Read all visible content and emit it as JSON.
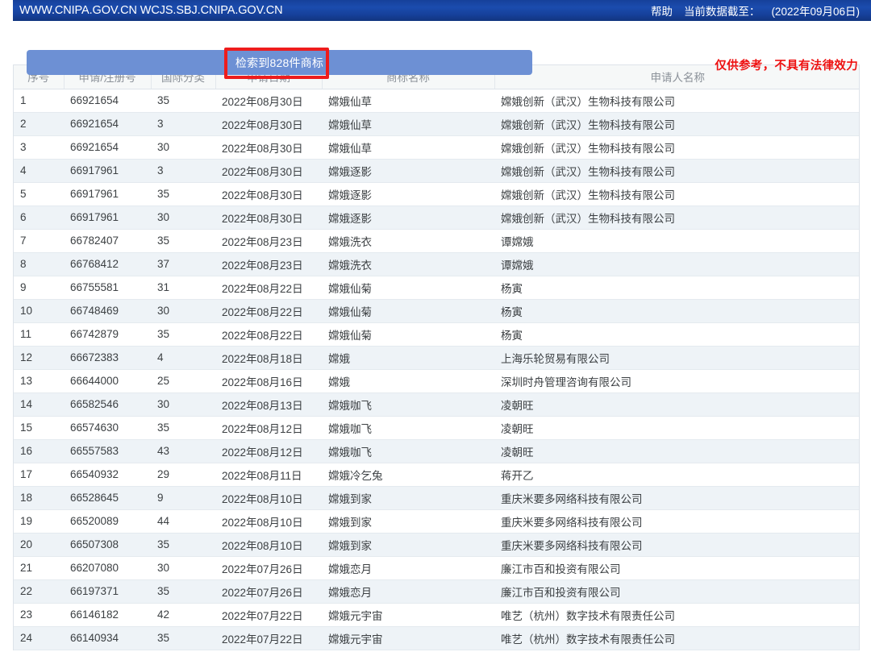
{
  "topbar": {
    "site_urls": "WWW.CNIPA.GOV.CN WCJS.SBJ.CNIPA.GOV.CN",
    "help_label": "帮助",
    "data_asof_label": "当前数据截至：",
    "data_asof_value": "(2022年09月06日)"
  },
  "banner": {
    "result_text": "检索到828件商标",
    "disclaimer": "仅供参考，不具有法律效力",
    "highlight_color": "#ee1c1c",
    "bar_color": "#6d90d4",
    "disclaimer_color": "#ee1111"
  },
  "table": {
    "columns": [
      "序号",
      "申请/注册号",
      "国际分类",
      "申请日期",
      "商标名称",
      "申请人名称"
    ],
    "rows": [
      {
        "seq": "1",
        "regno": "66921654",
        "cls": "35",
        "date": "2022年08月30日",
        "name": "嫦娥仙草",
        "applicant": "嫦娥创新（武汉）生物科技有限公司"
      },
      {
        "seq": "2",
        "regno": "66921654",
        "cls": "3",
        "date": "2022年08月30日",
        "name": "嫦娥仙草",
        "applicant": "嫦娥创新（武汉）生物科技有限公司"
      },
      {
        "seq": "3",
        "regno": "66921654",
        "cls": "30",
        "date": "2022年08月30日",
        "name": "嫦娥仙草",
        "applicant": "嫦娥创新（武汉）生物科技有限公司"
      },
      {
        "seq": "4",
        "regno": "66917961",
        "cls": "3",
        "date": "2022年08月30日",
        "name": "嫦娥逐影",
        "applicant": "嫦娥创新（武汉）生物科技有限公司"
      },
      {
        "seq": "5",
        "regno": "66917961",
        "cls": "35",
        "date": "2022年08月30日",
        "name": "嫦娥逐影",
        "applicant": "嫦娥创新（武汉）生物科技有限公司"
      },
      {
        "seq": "6",
        "regno": "66917961",
        "cls": "30",
        "date": "2022年08月30日",
        "name": "嫦娥逐影",
        "applicant": "嫦娥创新（武汉）生物科技有限公司"
      },
      {
        "seq": "7",
        "regno": "66782407",
        "cls": "35",
        "date": "2022年08月23日",
        "name": "嫦娥洗衣",
        "applicant": "谭嫦娥"
      },
      {
        "seq": "8",
        "regno": "66768412",
        "cls": "37",
        "date": "2022年08月23日",
        "name": "嫦娥洗衣",
        "applicant": "谭嫦娥"
      },
      {
        "seq": "9",
        "regno": "66755581",
        "cls": "31",
        "date": "2022年08月22日",
        "name": "嫦娥仙菊",
        "applicant": "杨寅"
      },
      {
        "seq": "10",
        "regno": "66748469",
        "cls": "30",
        "date": "2022年08月22日",
        "name": "嫦娥仙菊",
        "applicant": "杨寅"
      },
      {
        "seq": "11",
        "regno": "66742879",
        "cls": "35",
        "date": "2022年08月22日",
        "name": "嫦娥仙菊",
        "applicant": "杨寅"
      },
      {
        "seq": "12",
        "regno": "66672383",
        "cls": "4",
        "date": "2022年08月18日",
        "name": "嫦娥",
        "applicant": "上海乐轮贸易有限公司"
      },
      {
        "seq": "13",
        "regno": "66644000",
        "cls": "25",
        "date": "2022年08月16日",
        "name": "嫦娥",
        "applicant": "深圳时舟管理咨询有限公司"
      },
      {
        "seq": "14",
        "regno": "66582546",
        "cls": "30",
        "date": "2022年08月13日",
        "name": "嫦娥咖飞",
        "applicant": "凌朝旺"
      },
      {
        "seq": "15",
        "regno": "66574630",
        "cls": "35",
        "date": "2022年08月12日",
        "name": "嫦娥咖飞",
        "applicant": "凌朝旺"
      },
      {
        "seq": "16",
        "regno": "66557583",
        "cls": "43",
        "date": "2022年08月12日",
        "name": "嫦娥咖飞",
        "applicant": "凌朝旺"
      },
      {
        "seq": "17",
        "regno": "66540932",
        "cls": "29",
        "date": "2022年08月11日",
        "name": "嫦娥冷乞兔",
        "applicant": "蒋开乙"
      },
      {
        "seq": "18",
        "regno": "66528645",
        "cls": "9",
        "date": "2022年08月10日",
        "name": "嫦娥到家",
        "applicant": "重庆米要多网络科技有限公司"
      },
      {
        "seq": "19",
        "regno": "66520089",
        "cls": "44",
        "date": "2022年08月10日",
        "name": "嫦娥到家",
        "applicant": "重庆米要多网络科技有限公司"
      },
      {
        "seq": "20",
        "regno": "66507308",
        "cls": "35",
        "date": "2022年08月10日",
        "name": "嫦娥到家",
        "applicant": "重庆米要多网络科技有限公司"
      },
      {
        "seq": "21",
        "regno": "66207080",
        "cls": "30",
        "date": "2022年07月26日",
        "name": "嫦娥恋月",
        "applicant": "廉江市百和投资有限公司"
      },
      {
        "seq": "22",
        "regno": "66197371",
        "cls": "35",
        "date": "2022年07月26日",
        "name": "嫦娥恋月",
        "applicant": "廉江市百和投资有限公司"
      },
      {
        "seq": "23",
        "regno": "66146182",
        "cls": "42",
        "date": "2022年07月22日",
        "name": "嫦娥元宇宙",
        "applicant": "唯艺（杭州）数字技术有限责任公司"
      },
      {
        "seq": "24",
        "regno": "66140934",
        "cls": "35",
        "date": "2022年07月22日",
        "name": "嫦娥元宇宙",
        "applicant": "唯艺（杭州）数字技术有限责任公司"
      }
    ]
  }
}
